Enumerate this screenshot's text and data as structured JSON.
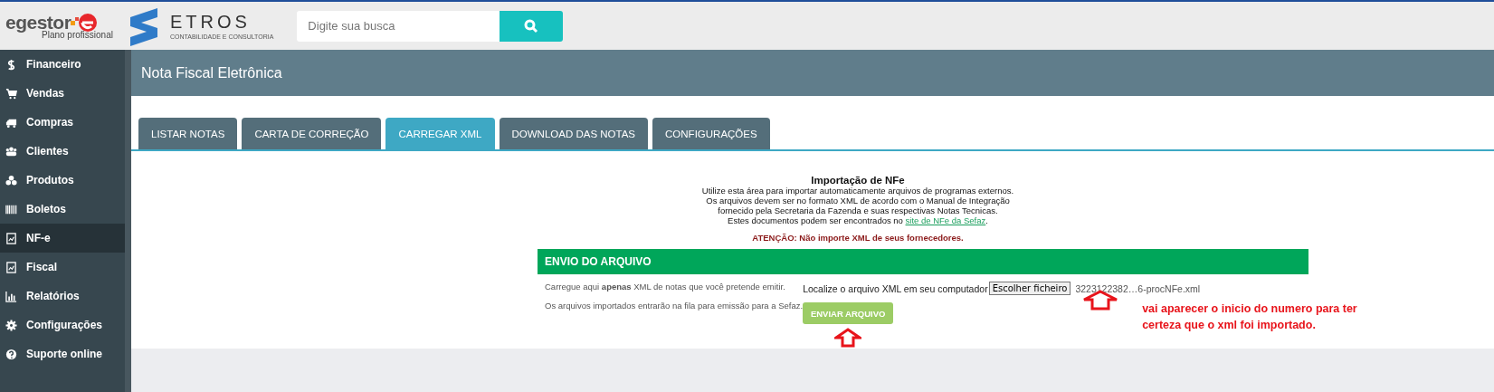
{
  "header": {
    "brand": {
      "name": "egestor",
      "plan": "Plano profissional"
    },
    "partner": {
      "name": "ETROS",
      "tagline": "CONTABILIDADE E CONSULTORIA"
    },
    "search": {
      "placeholder": "Digite sua busca"
    }
  },
  "sidebar": {
    "items": [
      {
        "label": "Financeiro",
        "selected": false
      },
      {
        "label": "Vendas",
        "selected": false
      },
      {
        "label": "Compras",
        "selected": false
      },
      {
        "label": "Clientes",
        "selected": false
      },
      {
        "label": "Produtos",
        "selected": false
      },
      {
        "label": "Boletos",
        "selected": false
      },
      {
        "label": "NF-e",
        "selected": true
      },
      {
        "label": "Fiscal",
        "selected": false
      },
      {
        "label": "Relatórios",
        "selected": false
      },
      {
        "label": "Configurações",
        "selected": false
      },
      {
        "label": "Suporte online",
        "selected": false
      }
    ]
  },
  "page": {
    "title": "Nota Fiscal Eletrônica"
  },
  "tabs": [
    {
      "label": "LISTAR NOTAS",
      "selected": false
    },
    {
      "label": "CARTA DE CORREÇÃO",
      "selected": false
    },
    {
      "label": "CARREGAR XML",
      "selected": true
    },
    {
      "label": "DOWNLOAD DAS NOTAS",
      "selected": false
    },
    {
      "label": "CONFIGURAÇÕES",
      "selected": false
    }
  ],
  "intro": {
    "heading": "Importação de NFe",
    "lines": [
      "Utilize esta área para importar automaticamente arquivos de programas externos.",
      "Os arquivos devem ser no formato XML de acordo com o Manual de Integração",
      "fornecido pela Secretaria da Fazenda e suas respectivas Notas Tecnicas."
    ],
    "link_prefix": "Estes documentos podem ser encontrados no ",
    "link": "site de NFe da Sefaz",
    "link_suffix": ".",
    "warning": "ATENÇÃO: Não importe XML de seus fornecedores."
  },
  "upload": {
    "title": "ENVIO DO ARQUIVO",
    "notes": [
      "Carregue aqui **apenas** XML de notas que você pretende emitir.",
      "Os arquivos importados entrarão na fila para emissão para a Sefaz."
    ],
    "file_label": "Localize o arquivo XML em seu computador",
    "choose_button": "Escolher ficheiro",
    "file_name": "3223122382…6-procNFe.xml",
    "send_button": "ENVIAR ARQUIVO"
  },
  "annotation": {
    "text": "vai aparecer o inicio do numero para ter certeza que o xml foi importado."
  }
}
